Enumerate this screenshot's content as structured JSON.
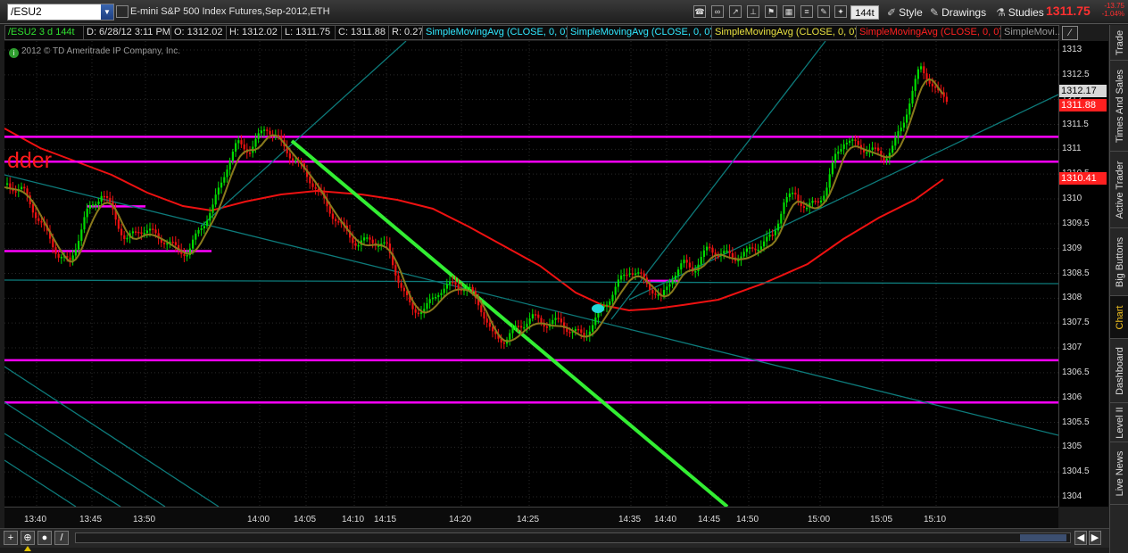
{
  "toolbar": {
    "symbol": "/ESU2",
    "description": "E-mini S&P 500 Index Futures,Sep-2012,ETH",
    "aggregation": "144t",
    "style_label": "Style",
    "drawings_label": "Drawings",
    "studies_label": "Studies",
    "last_price": "1311.75",
    "net_change": "-13.75",
    "pct_change": "-1.04%",
    "icons": [
      "checkbox-icon",
      "phone-icon",
      "link-icon",
      "share-icon",
      "plug-icon",
      "draw-tool-icon",
      "magic-wand-icon",
      "pencil-icon",
      "flask-icon",
      "flag-icon"
    ]
  },
  "infobar": {
    "symbol_agg": "/ESU2 3 d 144t",
    "datetime": "D: 6/28/12 3:11 PM",
    "open": "O: 1312.02",
    "high": "H: 1312.02",
    "low": "L: 1311.75",
    "close": "C: 1311.88",
    "range": "R: 0.27",
    "studies": [
      {
        "label": "SimpleMovingAvg (CLOSE, 0, 0)",
        "color": "#30e8ff"
      },
      {
        "label": "SimpleMovingAvg (CLOSE, 0, 0)",
        "color": "#30e8ff"
      },
      {
        "label": "SimpleMovingAvg (CLOSE, 0, 0)",
        "color": "#e8e040"
      },
      {
        "label": "SimpleMovingAvg (CLOSE, 0, 0)",
        "color": "#ff2020"
      },
      {
        "label": "SimpleMovi...",
        "color": "#9a9a9a"
      }
    ]
  },
  "chart": {
    "copyright": "2012 © TD Ameritrade IP Company, Inc.",
    "annotation": "dder",
    "price_ticks": [
      "1313",
      "1312.5",
      "1312",
      "1311.5",
      "1311",
      "1310.5",
      "1310",
      "1309.5",
      "1309",
      "1308.5",
      "1308",
      "1307.5",
      "1307",
      "1306.5",
      "1306",
      "1305.5",
      "1305",
      "1304.5",
      "1304"
    ],
    "price_labels": [
      {
        "text": "1312.17",
        "bg": "#d8d8d8",
        "fg": "#000000",
        "price": 1312.17
      },
      {
        "text": "1311.88",
        "bg": "#ff2020",
        "fg": "#ffffff",
        "price": 1311.88
      },
      {
        "text": "1310.41",
        "bg": "#ff2020",
        "fg": "#ffffff",
        "price": 1310.41
      }
    ],
    "time_ticks": [
      "13:40",
      "13:45",
      "13:50",
      "14:00",
      "14:05",
      "14:10",
      "14:15",
      "14:20",
      "14:25",
      "14:35",
      "14:40",
      "14:45",
      "14:50",
      "15:00",
      "15:05",
      "15:10"
    ],
    "colors": {
      "up": "#00dd00",
      "down": "#ee1111",
      "horizontal": "#ff00ff",
      "trend": "#0d7a7a",
      "green_trend": "#33ee33",
      "sma_fast": "#8a7a1c",
      "sma_slow": "#ee1111",
      "oval": "#22d8d8"
    }
  },
  "right_tabs": [
    "Trade",
    "Times And Sales",
    "Active Trader",
    "Big Buttons",
    "Chart",
    "Dashboard",
    "Level II",
    "Live News"
  ],
  "active_tab": "Chart",
  "bottombar": {
    "buttons": [
      "+",
      "⊕",
      "●",
      "/"
    ],
    "scroll": [
      "◀",
      "▶",
      "◀"
    ]
  }
}
